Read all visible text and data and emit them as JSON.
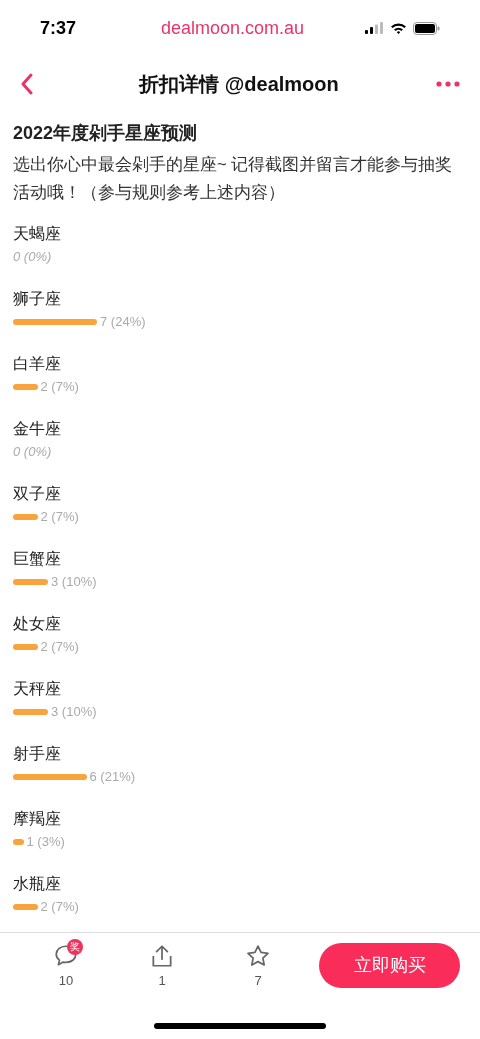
{
  "status_bar": {
    "time": "7:37",
    "url": "dealmoon.com.au"
  },
  "nav": {
    "title": "折扣详情 @dealmoon"
  },
  "poll": {
    "title": "2022年度剁手星座预测",
    "description": "选出你心中最会剁手的星座~ 记得截图并留言才能参与抽奖活动哦！（参与规则参考上述内容）",
    "options": [
      {
        "label": "天蝎座",
        "result": "0 (0%)"
      },
      {
        "label": "狮子座",
        "result": "7 (24%)"
      },
      {
        "label": "白羊座",
        "result": "2 (7%)"
      },
      {
        "label": "金牛座",
        "result": "0 (0%)"
      },
      {
        "label": "双子座",
        "result": "2 (7%)"
      },
      {
        "label": "巨蟹座",
        "result": "3 (10%)"
      },
      {
        "label": "处女座",
        "result": "2 (7%)"
      },
      {
        "label": "天秤座",
        "result": "3 (10%)"
      },
      {
        "label": "射手座",
        "result": "6 (21%)"
      },
      {
        "label": "摩羯座",
        "result": "1 (3%)"
      },
      {
        "label": "水瓶座",
        "result": "2 (7%)"
      }
    ]
  },
  "bottom_bar": {
    "actions": [
      {
        "kind": "comment",
        "badge": "奖",
        "count": "10"
      },
      {
        "kind": "share",
        "count": "1"
      },
      {
        "kind": "favorite",
        "count": "7"
      }
    ],
    "buy_button": "立即购买"
  }
}
